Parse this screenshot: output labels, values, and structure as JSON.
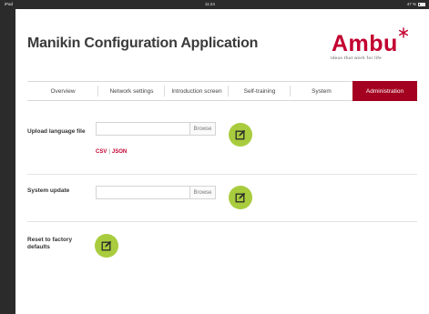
{
  "statusbar": {
    "carrier": "iPad",
    "time": "11:24",
    "right": "47 %"
  },
  "header": {
    "title": "Manikin Configuration Application",
    "logo_text": "Ambu",
    "logo_tagline": "Ideas that work for life",
    "logo_color": "#c2002f"
  },
  "tabs": [
    {
      "label": "Overview",
      "active": false
    },
    {
      "label": "Network settings",
      "active": false
    },
    {
      "label": "Introduction screen",
      "active": false
    },
    {
      "label": "Self-training",
      "active": false
    },
    {
      "label": "System",
      "active": false
    },
    {
      "label": "Administration",
      "active": true
    }
  ],
  "accent_color": "#a4001f",
  "action_color": "#a8cc3e",
  "sections": {
    "upload_language": {
      "label": "Upload language file",
      "value": "",
      "browse_label": "Browse",
      "link_csv": "CSV",
      "link_separator": "|",
      "link_json": "JSON",
      "button_icon": "edit-icon"
    },
    "system_update": {
      "label": "System update",
      "value": "",
      "browse_label": "Browse",
      "button_icon": "edit-icon"
    },
    "factory_reset": {
      "label": "Reset to factory defaults",
      "button_icon": "edit-icon"
    }
  }
}
